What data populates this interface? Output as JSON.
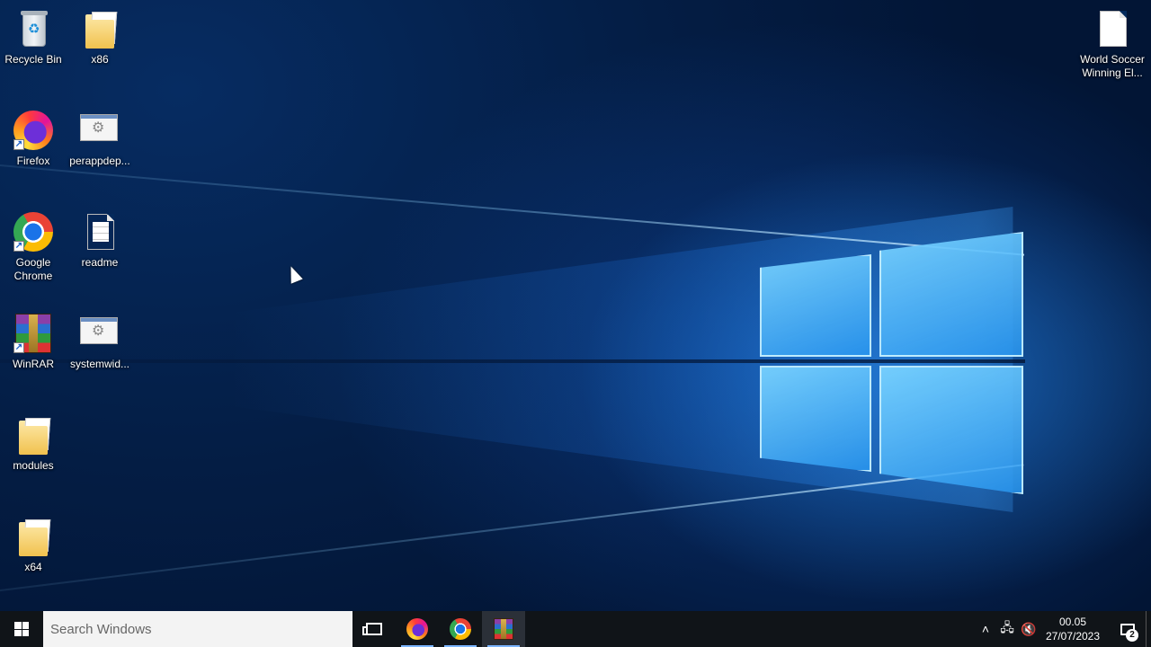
{
  "desktop": {
    "icons": [
      {
        "label": "Recycle Bin",
        "icon": "recycle-bin-icon"
      },
      {
        "label": "x86",
        "icon": "folder-icon"
      },
      {
        "label": "Firefox",
        "icon": "firefox-icon"
      },
      {
        "label": "perappdep...",
        "icon": "settings-file-icon"
      },
      {
        "label": "Google Chrome",
        "icon": "chrome-icon"
      },
      {
        "label": "readme",
        "icon": "text-document-icon"
      },
      {
        "label": "WinRAR",
        "icon": "winrar-icon"
      },
      {
        "label": "systemwid...",
        "icon": "settings-file-icon"
      },
      {
        "label": "modules",
        "icon": "folder-icon"
      },
      {
        "label": "x64",
        "icon": "folder-icon"
      },
      {
        "label": "World Soccer Winning El...",
        "icon": "document-icon"
      }
    ]
  },
  "taskbar": {
    "search_placeholder": "Search Windows",
    "apps": [
      {
        "name": "Firefox",
        "running": true
      },
      {
        "name": "Google Chrome",
        "running": true
      },
      {
        "name": "WinRAR",
        "running": true,
        "active": true
      }
    ],
    "clock": {
      "time": "00.05",
      "date": "27/07/2023"
    },
    "notification_count": "2",
    "colors": {
      "taskbar": "#101418",
      "accent": "#7bb4ff"
    }
  }
}
